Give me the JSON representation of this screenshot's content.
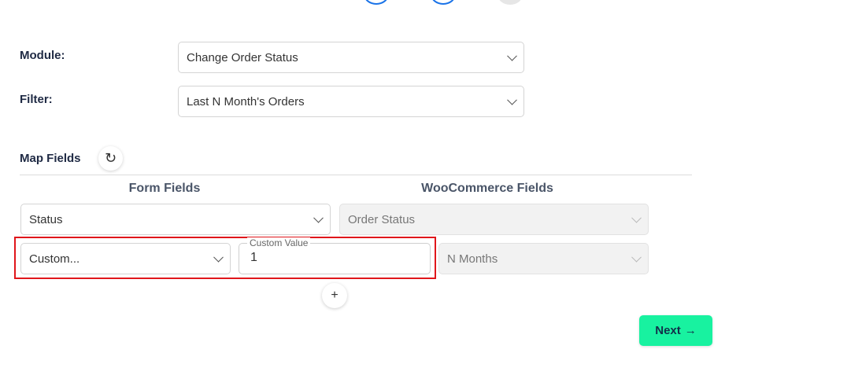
{
  "module": {
    "label": "Module:",
    "value": "Change Order Status"
  },
  "filter": {
    "label": "Filter:",
    "value": "Last N Month's Orders"
  },
  "map_fields": {
    "title": "Map Fields",
    "refresh_glyph": "↻",
    "form_fields_header": "Form Fields",
    "woo_fields_header": "WooCommerce Fields",
    "rows": [
      {
        "form_field": "Status",
        "woo_field": "Order Status"
      },
      {
        "form_field": "Custom...",
        "custom_value_label": "Custom Value",
        "custom_value": "1",
        "woo_field": "N Months"
      }
    ],
    "add_glyph": "+"
  },
  "next": {
    "label": "Next",
    "arrow": "→"
  },
  "colors": {
    "accent": "#18f2a0",
    "highlight": "#e0161b",
    "step_active": "#1a73e8"
  },
  "icons": [
    "refresh-icon",
    "chevron-down-icon",
    "plus-icon",
    "arrow-right-icon"
  ]
}
